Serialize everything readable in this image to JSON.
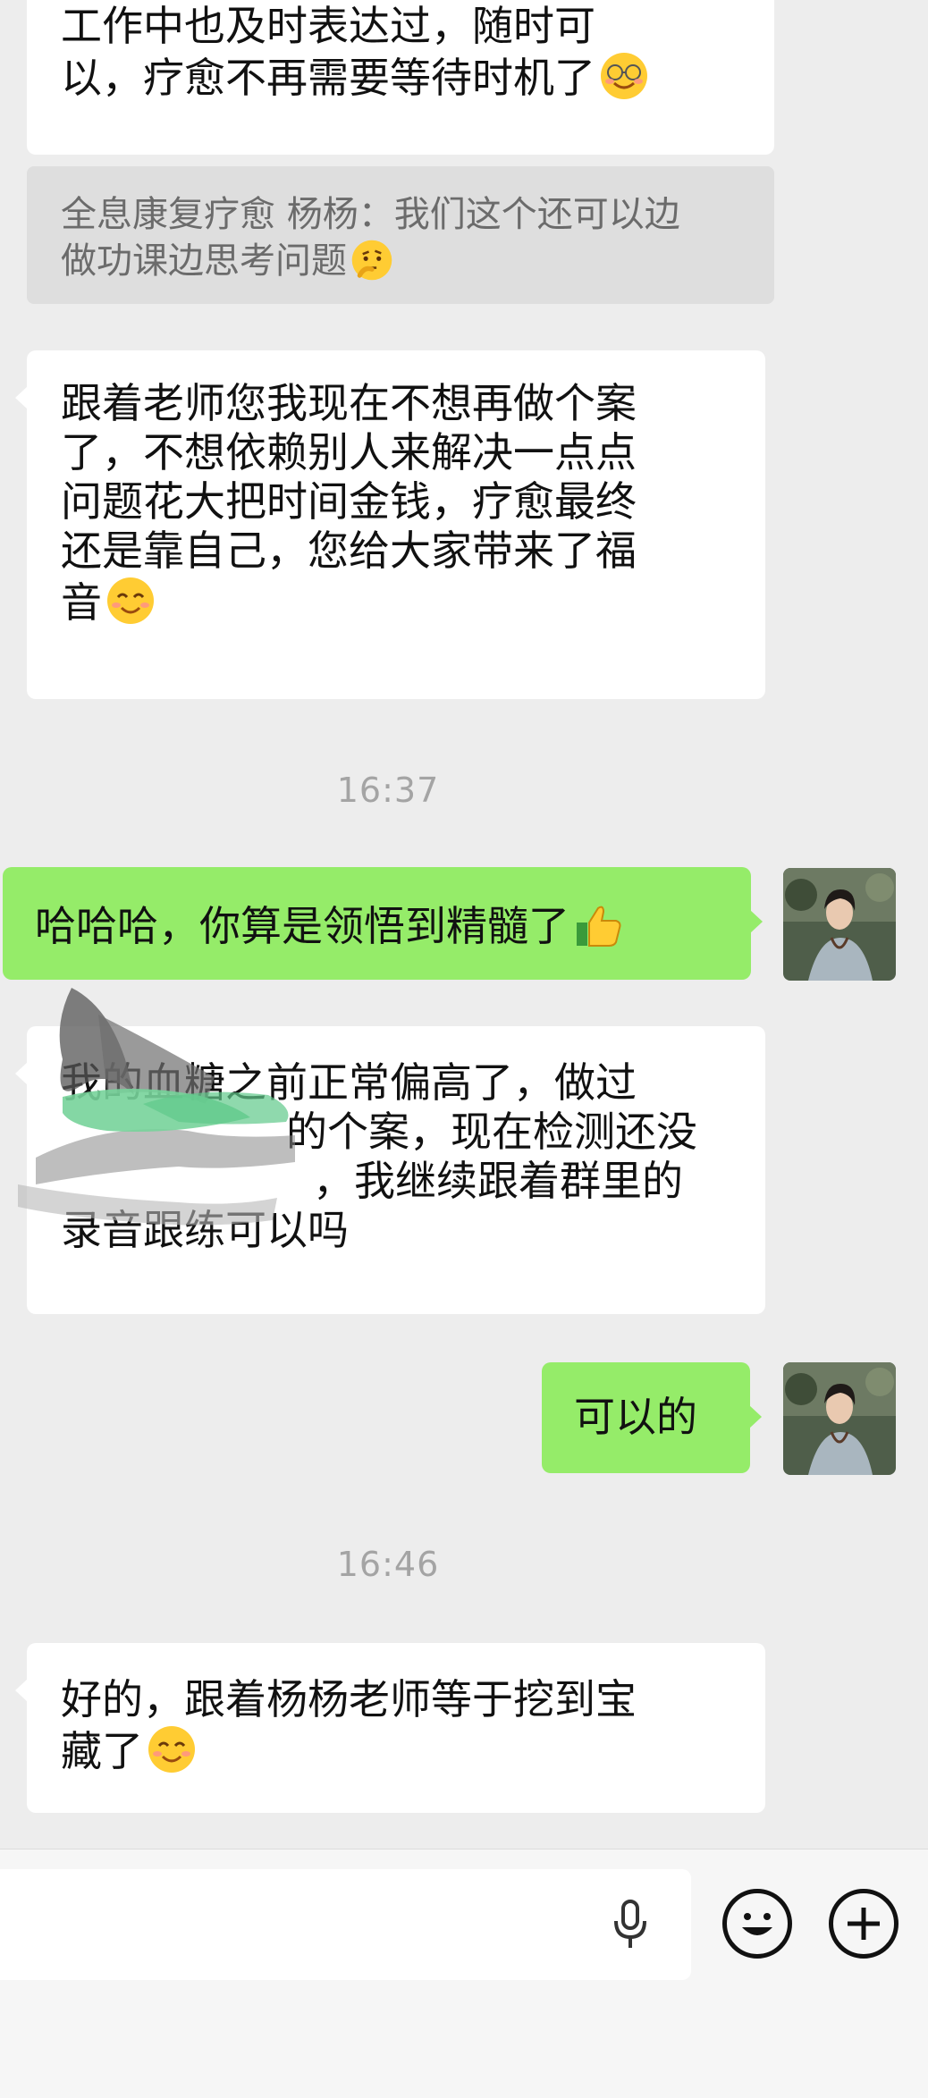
{
  "messages": [
    {
      "id": "m1",
      "direction": "incoming",
      "lines": [
        "工作中也及时表达过，随时可",
        "以，疗愈不再需要等待时机了"
      ],
      "emoji": "smiling-face-with-glasses-emoji"
    },
    {
      "id": "m1_quote",
      "type": "quote",
      "lines": [
        "全息康复疗愈 杨杨：我们这个还可以边",
        "做功课边思考问题"
      ],
      "emoji": "thinking-face-emoji"
    },
    {
      "id": "m2",
      "direction": "incoming",
      "lines": [
        "跟着老师您我现在不想再做个案",
        "了，不想依赖别人来解决一点点",
        "问题花大把时间金钱，疗愈最终",
        "还是靠自己，您给大家带来了福",
        "音"
      ],
      "emoji": "smiling-face-emoji"
    },
    {
      "id": "t1",
      "type": "timestamp",
      "text": "16:37"
    },
    {
      "id": "m3",
      "direction": "outgoing",
      "lines": [
        "哈哈哈，你算是领悟到精髓了"
      ],
      "emoji": "thumbs-up-emoji"
    },
    {
      "id": "m4",
      "direction": "incoming",
      "lines": [
        "我的血糖之前正常偏高了，做过",
        "的个案，现在检测还没",
        "，我继续跟着群里的",
        "录音跟练可以吗"
      ],
      "redacted": true
    },
    {
      "id": "m5",
      "direction": "outgoing",
      "lines": [
        "可以的"
      ]
    },
    {
      "id": "t2",
      "type": "timestamp",
      "text": "16:46"
    },
    {
      "id": "m6",
      "direction": "incoming",
      "lines": [
        "好的，跟着杨杨老师等于挖到宝",
        "藏了"
      ],
      "emoji": "smiling-face-emoji"
    }
  ],
  "colors": {
    "background": "#ededed",
    "incoming_bubble": "#ffffff",
    "outgoing_bubble": "#95ec69",
    "quote_bubble": "#dedede",
    "timestamp_text": "#a4a4a4"
  },
  "input_bar": {
    "icons": [
      "microphone-icon",
      "emoji-icon",
      "plus-icon"
    ]
  }
}
